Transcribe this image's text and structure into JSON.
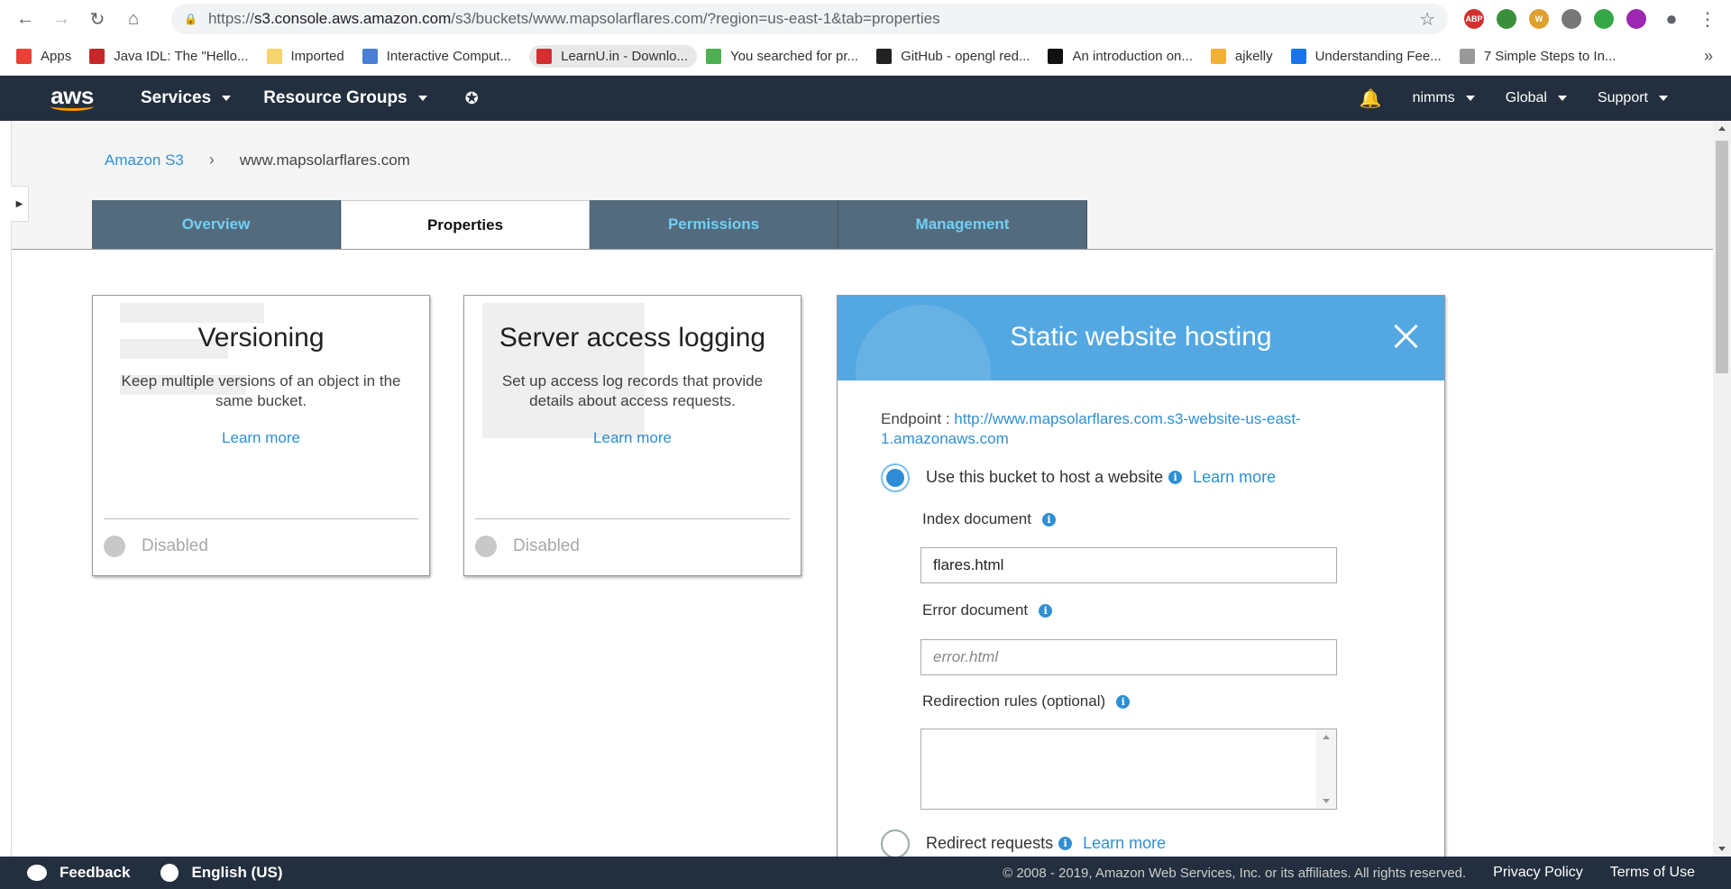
{
  "browser": {
    "url_prefix": "https://",
    "url_host": "s3.console.aws.amazon.com",
    "url_path": "/s3/buckets/www.mapsolarflares.com/?region=us-east-1&tab=properties",
    "bookmarks": [
      {
        "label": "Apps",
        "color": "#e94235"
      },
      {
        "label": "Java IDL: The \"Hello...",
        "color": "#c62828"
      },
      {
        "label": "Imported",
        "color": "#f6d36b"
      },
      {
        "label": "Interactive Comput...",
        "color": "#4a7fd4"
      },
      {
        "label": "LearnU.in - Downlo...",
        "color": "#d32f2f"
      },
      {
        "label": "You searched for pr...",
        "color": "#4caf50"
      },
      {
        "label": "GitHub - opengl red...",
        "color": "#222222"
      },
      {
        "label": "An introduction on...",
        "color": "#111111"
      },
      {
        "label": "ajkelly",
        "color": "#f2b134"
      },
      {
        "label": "Understanding Fee...",
        "color": "#1a73e8"
      },
      {
        "label": "7 Simple Steps to In...",
        "color": "#999999"
      }
    ],
    "extensions": [
      {
        "name": "adblock-plus-icon",
        "text": "ABP",
        "color": "#d32f2f"
      },
      {
        "name": "extension-green-icon",
        "text": "",
        "color": "#3a8f3a"
      },
      {
        "name": "extension-w-icon",
        "text": "W",
        "color": "#e0a030"
      },
      {
        "name": "extension-grey-icon",
        "text": "",
        "color": "#777777"
      },
      {
        "name": "extension-compass-icon",
        "text": "",
        "color": "#35a845"
      },
      {
        "name": "extension-purple-icon",
        "text": "",
        "color": "#9c27b0"
      }
    ]
  },
  "aws_nav": {
    "logo": "aws",
    "services": "Services",
    "resource_groups": "Resource Groups",
    "user": "nimms",
    "region": "Global",
    "support": "Support"
  },
  "breadcrumb": {
    "root": "Amazon S3",
    "current": "www.mapsolarflares.com"
  },
  "tabs": [
    "Overview",
    "Properties",
    "Permissions",
    "Management"
  ],
  "cards": {
    "versioning": {
      "title": "Versioning",
      "desc": "Keep multiple versions of an object in the same bucket.",
      "learn": "Learn more",
      "status": "Disabled"
    },
    "logging": {
      "title": "Server access logging",
      "desc": "Set up access log records that provide details about access requests.",
      "learn": "Learn more",
      "status": "Disabled"
    }
  },
  "static_hosting": {
    "title": "Static website hosting",
    "endpoint_label": "Endpoint : ",
    "endpoint_url": "http://www.mapsolarflares.com.s3-website-us-east-1.amazonaws.com",
    "use_bucket_label": "Use this bucket to host a website",
    "learn": "Learn more",
    "index_label": "Index document",
    "index_value": "flares.html",
    "error_label": "Error document",
    "error_placeholder": "error.html",
    "redirection_label": "Redirection rules (optional)",
    "redirect_label": "Redirect requests"
  },
  "footer": {
    "feedback": "Feedback",
    "language": "English (US)",
    "copyright": "© 2008 - 2019, Amazon Web Services, Inc. or its affiliates. All rights reserved.",
    "privacy": "Privacy Policy",
    "terms": "Terms of Use"
  },
  "colors": {
    "aws_nav_bg": "#232f3e",
    "tab_bg": "#546b7d",
    "tab_text": "#6fd0f6",
    "link": "#2f8fd2",
    "hosting_header": "#53a8e2"
  }
}
